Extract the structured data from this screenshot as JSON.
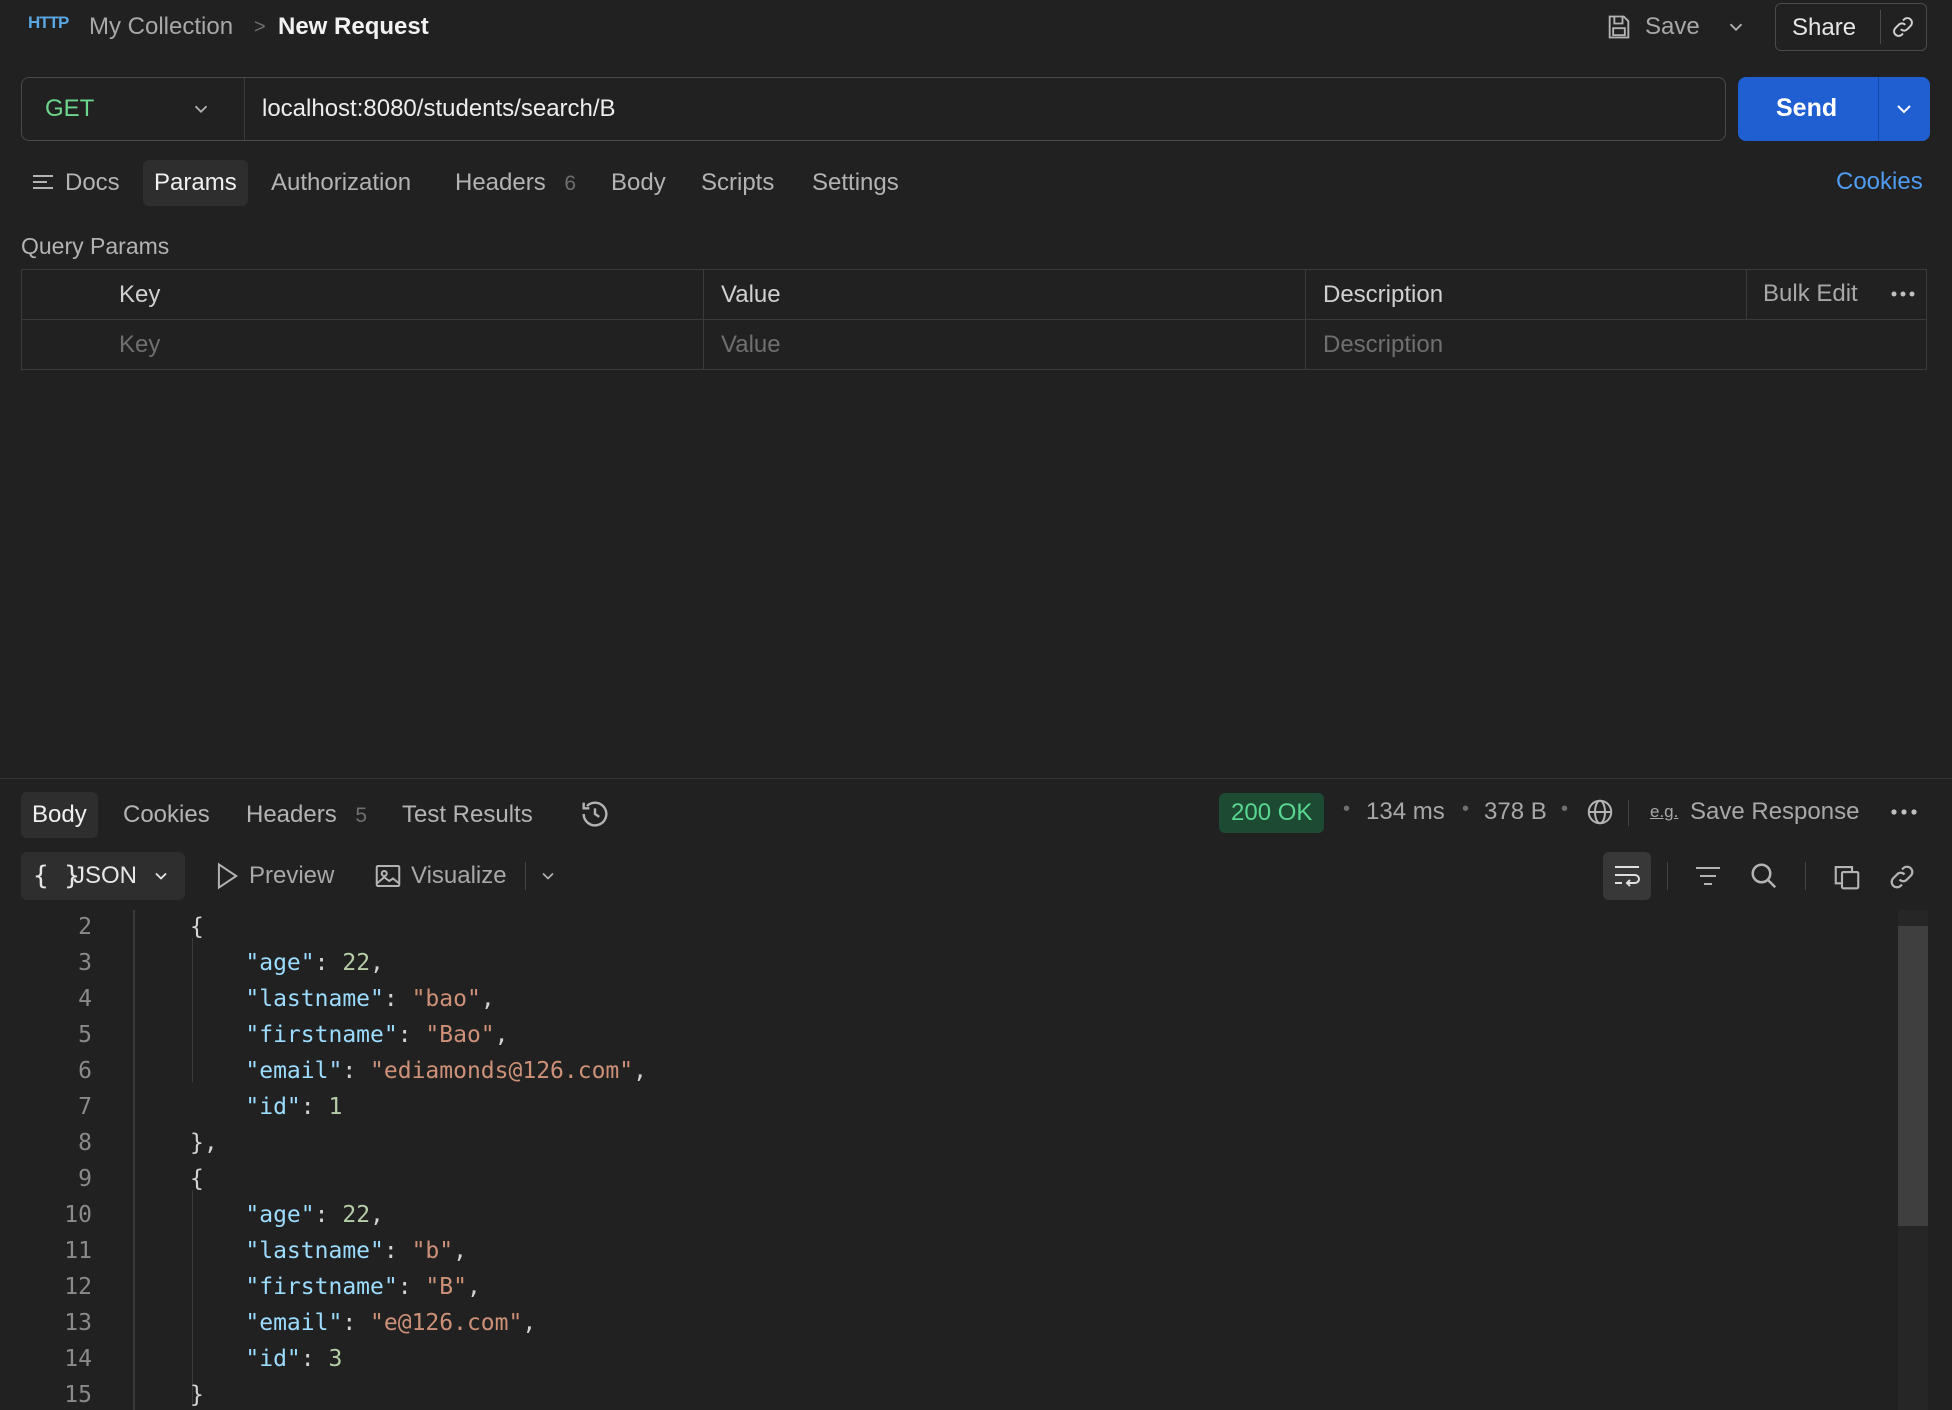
{
  "header": {
    "logo_text": "HTTP",
    "breadcrumb_parent": "My Collection",
    "breadcrumb_sep": ">",
    "breadcrumb_current": "New Request",
    "save_label": "Save",
    "share_label": "Share"
  },
  "request": {
    "method": "GET",
    "url": "localhost:8080/students/search/B",
    "send_label": "Send"
  },
  "request_tabs": {
    "docs": "Docs",
    "params": "Params",
    "authorization": "Authorization",
    "headers": "Headers",
    "headers_count": "6",
    "body": "Body",
    "scripts": "Scripts",
    "settings": "Settings",
    "cookies": "Cookies"
  },
  "params": {
    "section_title": "Query Params",
    "col_key": "Key",
    "col_value": "Value",
    "col_description": "Description",
    "bulk_edit": "Bulk Edit",
    "placeholder_key": "Key",
    "placeholder_value": "Value",
    "placeholder_description": "Description"
  },
  "response_tabs": {
    "body": "Body",
    "cookies": "Cookies",
    "headers": "Headers",
    "headers_count": "5",
    "test_results": "Test Results"
  },
  "response_meta": {
    "status": "200 OK",
    "time": "134 ms",
    "size": "378 B",
    "save_response": "Save Response",
    "eg_label": "e.g."
  },
  "viewer": {
    "format": "JSON",
    "preview": "Preview",
    "visualize": "Visualize"
  },
  "code_lines": [
    {
      "n": "2",
      "t": "    {"
    },
    {
      "n": "3",
      "t": "        \"age\": 22,"
    },
    {
      "n": "4",
      "t": "        \"lastname\": \"bao\","
    },
    {
      "n": "5",
      "t": "        \"firstname\": \"Bao\","
    },
    {
      "n": "6",
      "t": "        \"email\": \"ediamonds@126.com\","
    },
    {
      "n": "7",
      "t": "        \"id\": 1"
    },
    {
      "n": "8",
      "t": "    },"
    },
    {
      "n": "9",
      "t": "    {"
    },
    {
      "n": "10",
      "t": "        \"age\": 22,"
    },
    {
      "n": "11",
      "t": "        \"lastname\": \"b\","
    },
    {
      "n": "12",
      "t": "        \"firstname\": \"B\","
    },
    {
      "n": "13",
      "t": "        \"email\": \"e@126.com\","
    },
    {
      "n": "14",
      "t": "        \"id\": 3"
    },
    {
      "n": "15",
      "t": "    }"
    }
  ],
  "colors": {
    "accent": "#1f5fd1",
    "status_ok_bg": "#1d4a33",
    "status_ok_fg": "#59d68f",
    "link": "#4f9cf0"
  },
  "icons": [
    "http-logo-icon",
    "save-icon",
    "chevron-down-icon",
    "link-icon",
    "docs-icon",
    "more-icon",
    "history-icon",
    "globe-icon",
    "braces-icon",
    "play-icon",
    "image-icon",
    "wrap-icon",
    "filter-icon",
    "search-icon",
    "copy-icon"
  ]
}
